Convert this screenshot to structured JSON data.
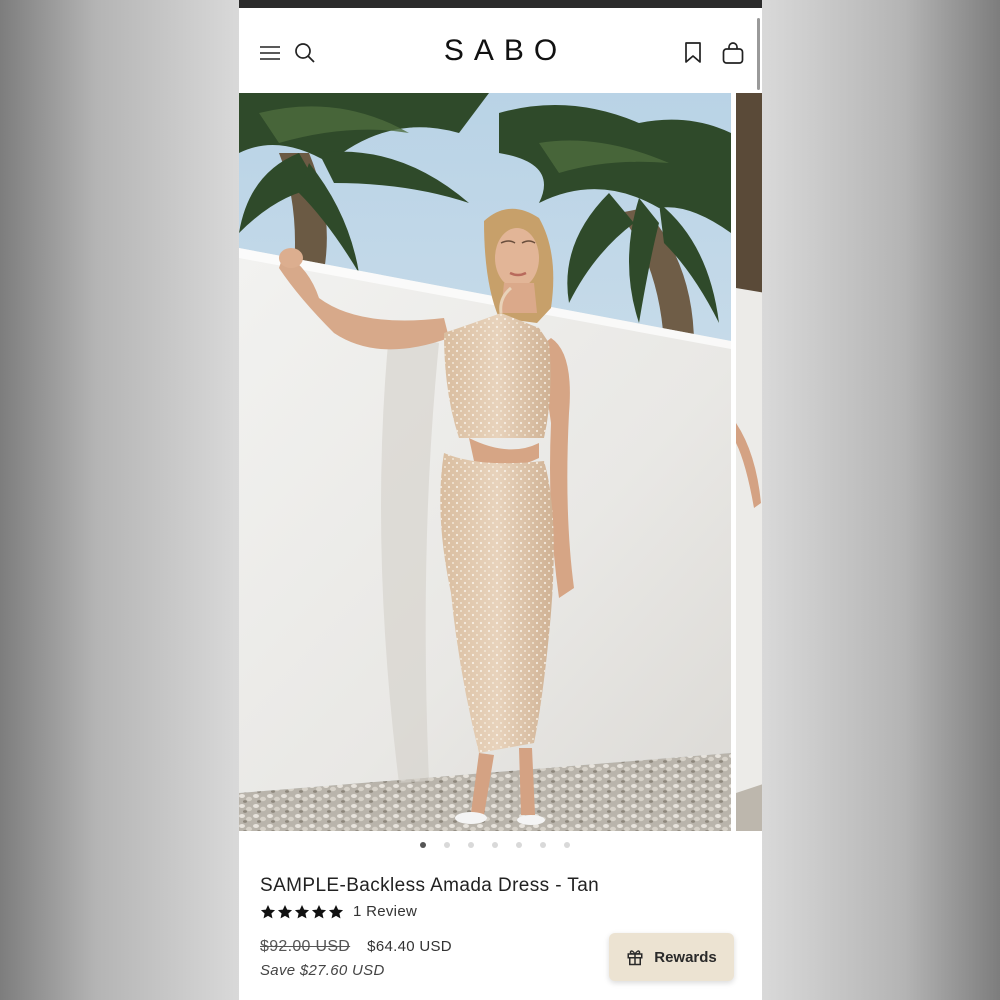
{
  "header": {
    "logo": "SABO",
    "menu_icon": "hamburger-menu-icon",
    "search_icon": "search-icon",
    "wishlist_icon": "bookmark-icon",
    "cart_icon": "shopping-bag-icon"
  },
  "gallery": {
    "image_count": 7,
    "active_index": 0
  },
  "product": {
    "title": "SAMPLE-Backless Amada Dress - Tan",
    "rating": 5,
    "review_text": "1 Review",
    "original_price": "$92.00 USD",
    "sale_price": "$64.40 USD",
    "savings": "Save $27.60 USD"
  },
  "rewards": {
    "label": "Rewards",
    "icon": "gift-icon"
  },
  "colors": {
    "rewards_bg": "#ece3d2",
    "star": "#111111"
  }
}
